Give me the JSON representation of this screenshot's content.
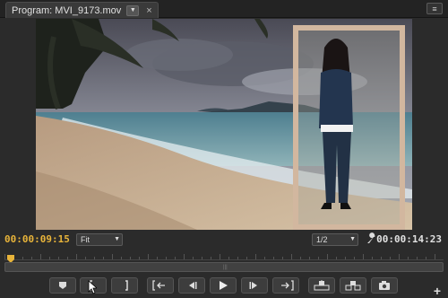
{
  "panel": {
    "tab_title": "Program: MVI_9173.mov",
    "tab_dropdown_icon": "chevron-down-icon",
    "tab_close_glyph": "×",
    "menu_icon": "panel-menu-icon"
  },
  "status": {
    "current_timecode": "00:00:09:15",
    "zoom_value": "Fit",
    "resolution_value": "1/2",
    "duration_timecode": "00:00:14:23"
  },
  "colors": {
    "accent_timecode": "#e8b43a",
    "panel_bg": "#2b2b2b"
  },
  "transport": {
    "buttons": [
      {
        "name": "add-marker-button",
        "icon": "marker-icon"
      },
      {
        "name": "mark-in-button",
        "icon": "mark-in-icon"
      },
      {
        "name": "mark-out-button",
        "icon": "mark-out-icon"
      },
      {
        "name": "go-to-in-button",
        "icon": "go-to-in-icon"
      },
      {
        "name": "step-back-button",
        "icon": "step-back-icon"
      },
      {
        "name": "play-button",
        "icon": "play-icon"
      },
      {
        "name": "step-forward-button",
        "icon": "step-forward-icon"
      },
      {
        "name": "go-to-out-button",
        "icon": "go-to-out-icon"
      },
      {
        "name": "lift-button",
        "icon": "lift-icon"
      },
      {
        "name": "extract-button",
        "icon": "extract-icon"
      },
      {
        "name": "export-frame-button",
        "icon": "camera-icon"
      }
    ],
    "add_button_glyph": "+"
  }
}
